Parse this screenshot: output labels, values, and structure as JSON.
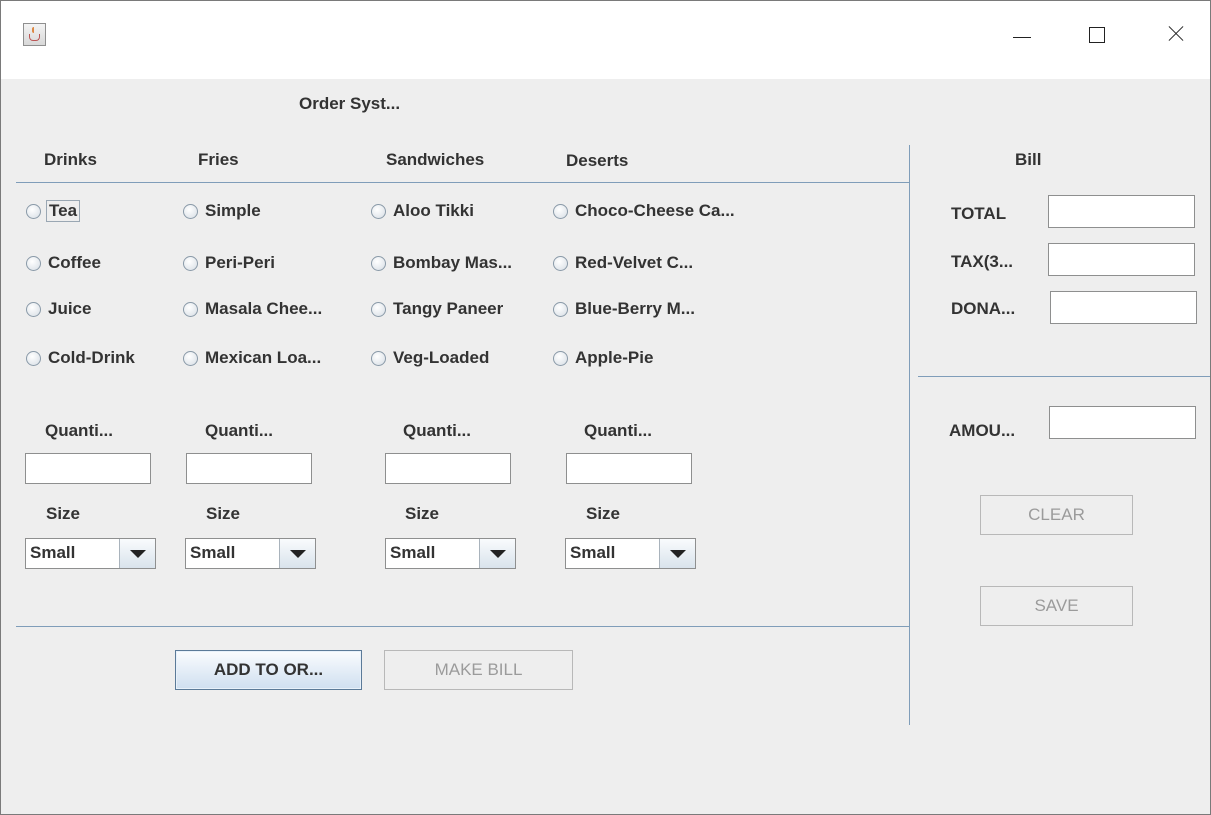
{
  "window": {
    "title": "",
    "icon": "java-cup-icon",
    "controls": [
      "minimize-icon",
      "maximize-icon",
      "close-icon"
    ]
  },
  "heading": "Order Syst...",
  "categories": [
    {
      "label": "Drinks",
      "items": [
        "Tea",
        "Coffee",
        "Juice",
        "Cold-Drink"
      ],
      "quantity_label": "Quanti...",
      "quantity_value": "",
      "size_label": "Size",
      "size_selected": "Small"
    },
    {
      "label": "Fries",
      "items": [
        "Simple",
        "Peri-Peri",
        "Masala Chee...",
        "Mexican Loa..."
      ],
      "quantity_label": "Quanti...",
      "quantity_value": "",
      "size_label": "Size",
      "size_selected": "Small"
    },
    {
      "label": "Sandwiches",
      "items": [
        "Aloo Tikki",
        "Bombay Mas...",
        "Tangy Paneer",
        "Veg-Loaded"
      ],
      "quantity_label": "Quanti...",
      "quantity_value": "",
      "size_label": "Size",
      "size_selected": "Small"
    },
    {
      "label": "Deserts",
      "items": [
        "Choco-Cheese Ca...",
        "Red-Velvet C...",
        "Blue-Berry M...",
        "Apple-Pie"
      ],
      "quantity_label": "Quanti...",
      "quantity_value": "",
      "size_label": "Size",
      "size_selected": "Small"
    }
  ],
  "buttons": {
    "add_to_order": "ADD TO OR...",
    "make_bill": "MAKE BILL",
    "clear": "CLEAR",
    "save": "SAVE"
  },
  "bill": {
    "title": "Bill",
    "total_label": "TOTAL",
    "total_value": "",
    "tax_label": "TAX(3...",
    "tax_value": "",
    "donation_label": "DONA...",
    "donation_value": "",
    "amount_label": "AMOU...",
    "amount_value": ""
  },
  "colors": {
    "window_bg": "#eeeeee",
    "separator": "#7f9db9",
    "text": "#333333",
    "disabled_text": "#9b9b9b"
  }
}
